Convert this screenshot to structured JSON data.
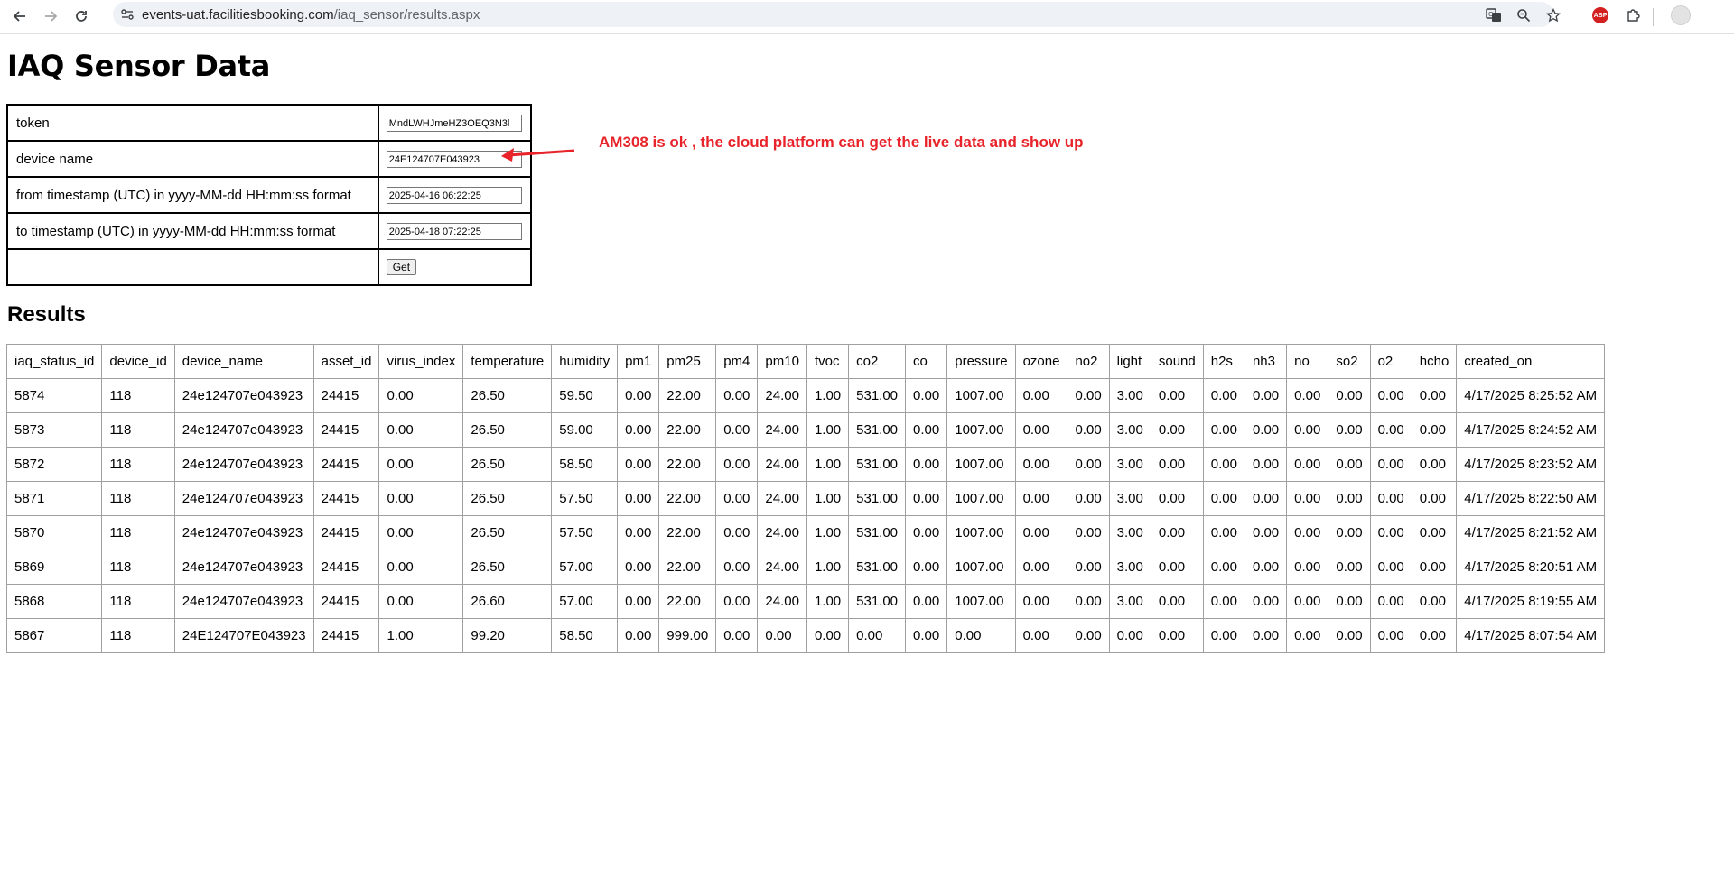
{
  "browser": {
    "url_host": "events-uat.facilitiesbooking.com",
    "url_path": "/iaq_sensor/results.aspx"
  },
  "page": {
    "title": "IAQ Sensor Data",
    "results_title": "Results"
  },
  "form": {
    "token_label": "token",
    "token_value": "MndLWHJmeHZ3OEQ3N3l",
    "device_name_label": "device name",
    "device_name_value": "24E124707E043923",
    "from_label": "from timestamp (UTC) in yyyy-MM-dd HH:mm:ss format",
    "from_value": "2025-04-16 06:22:25",
    "to_label": "to timestamp (UTC) in yyyy-MM-dd HH:mm:ss format",
    "to_value": "2025-04-18 07:22:25",
    "get_button": "Get"
  },
  "annotation": {
    "text": "AM308 is ok , the cloud platform can get the live data and show up",
    "color": "#e8232a"
  },
  "results": {
    "columns": [
      "iaq_status_id",
      "device_id",
      "device_name",
      "asset_id",
      "virus_index",
      "temperature",
      "humidity",
      "pm1",
      "pm25",
      "pm4",
      "pm10",
      "tvoc",
      "co2",
      "co",
      "pressure",
      "ozone",
      "no2",
      "light",
      "sound",
      "h2s",
      "nh3",
      "no",
      "so2",
      "o2",
      "hcho",
      "created_on"
    ],
    "rows": [
      [
        "5874",
        "118",
        "24e124707e043923",
        "24415",
        "0.00",
        "26.50",
        "59.50",
        "0.00",
        "22.00",
        "0.00",
        "24.00",
        "1.00",
        "531.00",
        "0.00",
        "1007.00",
        "0.00",
        "0.00",
        "3.00",
        "0.00",
        "0.00",
        "0.00",
        "0.00",
        "0.00",
        "0.00",
        "0.00",
        "4/17/2025 8:25:52 AM"
      ],
      [
        "5873",
        "118",
        "24e124707e043923",
        "24415",
        "0.00",
        "26.50",
        "59.00",
        "0.00",
        "22.00",
        "0.00",
        "24.00",
        "1.00",
        "531.00",
        "0.00",
        "1007.00",
        "0.00",
        "0.00",
        "3.00",
        "0.00",
        "0.00",
        "0.00",
        "0.00",
        "0.00",
        "0.00",
        "0.00",
        "4/17/2025 8:24:52 AM"
      ],
      [
        "5872",
        "118",
        "24e124707e043923",
        "24415",
        "0.00",
        "26.50",
        "58.50",
        "0.00",
        "22.00",
        "0.00",
        "24.00",
        "1.00",
        "531.00",
        "0.00",
        "1007.00",
        "0.00",
        "0.00",
        "3.00",
        "0.00",
        "0.00",
        "0.00",
        "0.00",
        "0.00",
        "0.00",
        "0.00",
        "4/17/2025 8:23:52 AM"
      ],
      [
        "5871",
        "118",
        "24e124707e043923",
        "24415",
        "0.00",
        "26.50",
        "57.50",
        "0.00",
        "22.00",
        "0.00",
        "24.00",
        "1.00",
        "531.00",
        "0.00",
        "1007.00",
        "0.00",
        "0.00",
        "3.00",
        "0.00",
        "0.00",
        "0.00",
        "0.00",
        "0.00",
        "0.00",
        "0.00",
        "4/17/2025 8:22:50 AM"
      ],
      [
        "5870",
        "118",
        "24e124707e043923",
        "24415",
        "0.00",
        "26.50",
        "57.50",
        "0.00",
        "22.00",
        "0.00",
        "24.00",
        "1.00",
        "531.00",
        "0.00",
        "1007.00",
        "0.00",
        "0.00",
        "3.00",
        "0.00",
        "0.00",
        "0.00",
        "0.00",
        "0.00",
        "0.00",
        "0.00",
        "4/17/2025 8:21:52 AM"
      ],
      [
        "5869",
        "118",
        "24e124707e043923",
        "24415",
        "0.00",
        "26.50",
        "57.00",
        "0.00",
        "22.00",
        "0.00",
        "24.00",
        "1.00",
        "531.00",
        "0.00",
        "1007.00",
        "0.00",
        "0.00",
        "3.00",
        "0.00",
        "0.00",
        "0.00",
        "0.00",
        "0.00",
        "0.00",
        "0.00",
        "4/17/2025 8:20:51 AM"
      ],
      [
        "5868",
        "118",
        "24e124707e043923",
        "24415",
        "0.00",
        "26.60",
        "57.00",
        "0.00",
        "22.00",
        "0.00",
        "24.00",
        "1.00",
        "531.00",
        "0.00",
        "1007.00",
        "0.00",
        "0.00",
        "3.00",
        "0.00",
        "0.00",
        "0.00",
        "0.00",
        "0.00",
        "0.00",
        "0.00",
        "4/17/2025 8:19:55 AM"
      ],
      [
        "5867",
        "118",
        "24E124707E043923",
        "24415",
        "1.00",
        "99.20",
        "58.50",
        "0.00",
        "999.00",
        "0.00",
        "0.00",
        "0.00",
        "0.00",
        "0.00",
        "0.00",
        "0.00",
        "0.00",
        "0.00",
        "0.00",
        "0.00",
        "0.00",
        "0.00",
        "0.00",
        "0.00",
        "0.00",
        "4/17/2025 8:07:54 AM"
      ]
    ]
  }
}
